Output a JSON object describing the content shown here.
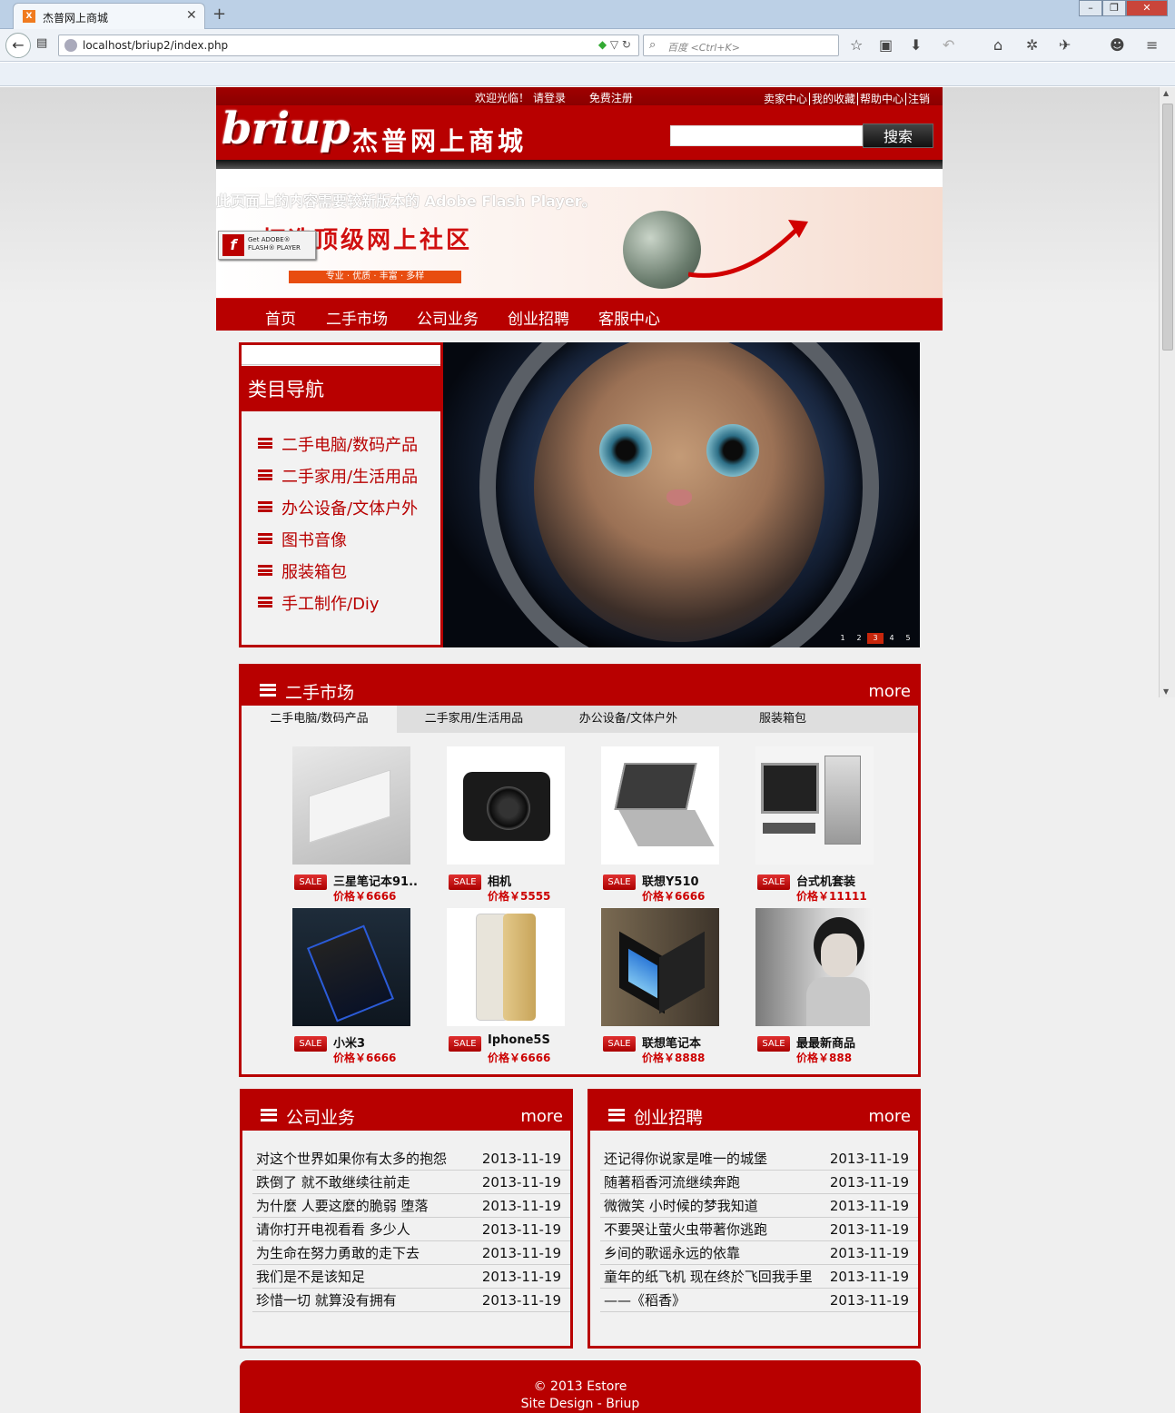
{
  "browser": {
    "tab_title": "杰普网上商城",
    "tab_icon": "xampp-icon",
    "url": "localhost/briup2/index.php",
    "search_placeholder": "百度 <Ctrl+K>"
  },
  "header": {
    "welcome": "欢迎光临！",
    "login": "请登录",
    "register": "免费注册",
    "links": [
      "卖家中心",
      "我的收藏",
      "帮助中心",
      "注销"
    ],
    "logo": "briup",
    "logo_subtitle": "杰普网上商城",
    "search_button": "搜索"
  },
  "banner": {
    "flash_message": "此页面上的内容需要较新版本的 Adobe Flash Player。",
    "title": "打造顶级网上社区",
    "subtitle": "专业 · 优质 · 丰富 · 多样",
    "flash_badge_line1": "Get ADOBE®",
    "flash_badge_line2": "FLASH® PLAYER"
  },
  "main_nav": [
    "首页",
    "二手市场",
    "公司业务",
    "创业招聘",
    "客服中心"
  ],
  "category": {
    "title": "类目导航",
    "items": [
      "二手电脑/数码产品",
      "二手家用/生活用品",
      "办公设备/文体户外",
      "图书音像",
      "服装箱包",
      "手工制作/Diy"
    ]
  },
  "slider": {
    "pages": [
      "1",
      "2",
      "3",
      "4",
      "5"
    ],
    "active": "3"
  },
  "market": {
    "title": "二手市场",
    "more": "more",
    "tabs": [
      "二手电脑/数码产品",
      "二手家用/生活用品",
      "办公设备/文体户外",
      "服装箱包"
    ],
    "sale_label": "SALE",
    "products": [
      {
        "name": "三星笔记本91..",
        "price": "价格￥6666"
      },
      {
        "name": "相机",
        "price": "价格￥5555"
      },
      {
        "name": "联想Y510",
        "price": "价格￥6666"
      },
      {
        "name": "台式机套装",
        "price": "价格￥11111"
      },
      {
        "name": "小米3",
        "price": "价格￥6666"
      },
      {
        "name": "Iphone5S",
        "price": "价格￥6666"
      },
      {
        "name": "联想笔记本",
        "price": "价格￥8888"
      },
      {
        "name": "最最新商品",
        "price": "价格￥888"
      }
    ]
  },
  "company": {
    "title": "公司业务",
    "more": "more",
    "items": [
      {
        "title": "对这个世界如果你有太多的抱怨",
        "date": "2013-11-19"
      },
      {
        "title": "跌倒了 就不敢继续往前走",
        "date": "2013-11-19"
      },
      {
        "title": "为什麼 人要这麼的脆弱 堕落",
        "date": "2013-11-19"
      },
      {
        "title": "请你打开电视看看 多少人",
        "date": "2013-11-19"
      },
      {
        "title": "为生命在努力勇敢的走下去",
        "date": "2013-11-19"
      },
      {
        "title": "我们是不是该知足",
        "date": "2013-11-19"
      },
      {
        "title": "珍惜一切 就算没有拥有",
        "date": "2013-11-19"
      }
    ]
  },
  "jobs": {
    "title": "创业招聘",
    "more": "more",
    "items": [
      {
        "title": "还记得你说家是唯一的城堡",
        "date": "2013-11-19"
      },
      {
        "title": "随著稻香河流继续奔跑",
        "date": "2013-11-19"
      },
      {
        "title": "微微笑 小时候的梦我知道",
        "date": "2013-11-19"
      },
      {
        "title": "不要哭让萤火虫带著你逃跑",
        "date": "2013-11-19"
      },
      {
        "title": "乡间的歌谣永远的依靠",
        "date": "2013-11-19"
      },
      {
        "title": "童年的纸飞机 现在终於飞回我手里",
        "date": "2013-11-19"
      },
      {
        "title": "——《稻香》",
        "date": "2013-11-19"
      }
    ]
  },
  "footer": {
    "line1": "© 2013 Estore",
    "line2": "Site Design - Briup"
  },
  "colors": {
    "brand_red": "#b80000",
    "price_red": "#cc0000"
  }
}
